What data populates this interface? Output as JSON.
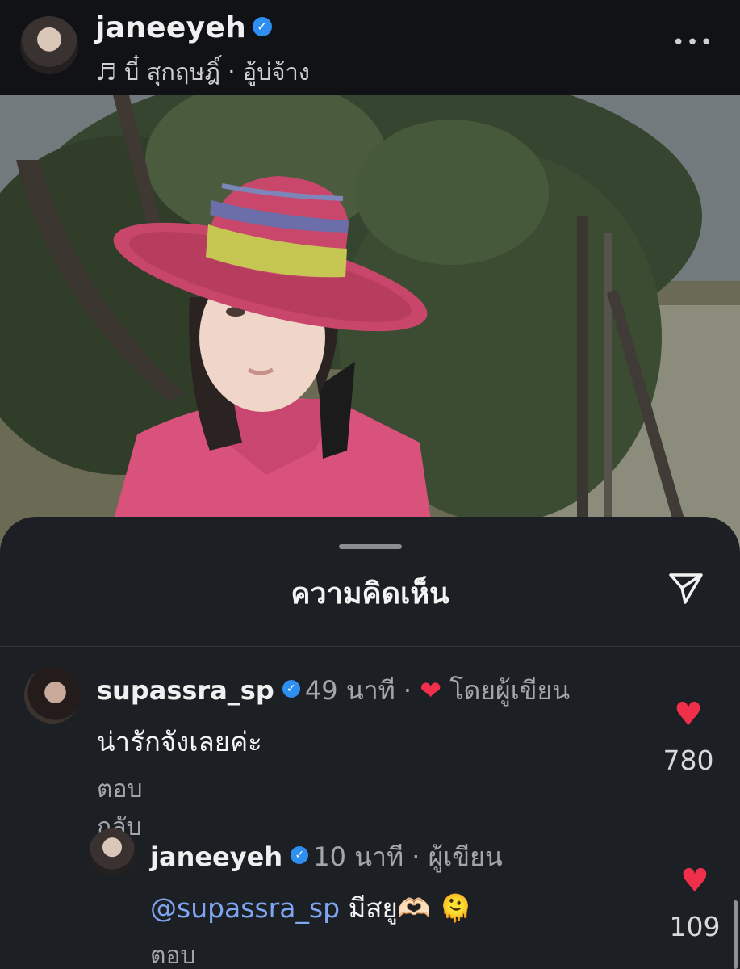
{
  "header": {
    "username": "janeeyeh",
    "music_icon": "♬",
    "music": "บี๋ สุกฤษฎิ์ · อู้บ่จ้าง",
    "more_icon": "•••"
  },
  "sheet": {
    "title": "ความคิดเห็น"
  },
  "comments": [
    {
      "user": "supassra_sp",
      "meta_time": "49 นาที · ",
      "heart": "❤",
      "meta_tag": " โดยผู้เขียน",
      "text": "น่ารักจังเลยค่ะ",
      "reply_label": "ตอบกลับ",
      "like_count": "780"
    },
    {
      "user": "janeeyeh",
      "meta_time": "10 นาที · ผู้เขียน",
      "mention": "@supassra_sp",
      "text": " มีสยู🫶🏻 🫠",
      "reply_label": "ตอบกลับ",
      "like_count": "109"
    }
  ],
  "colors": {
    "accent_heart": "#ef2f4c",
    "verified": "#2f8ff0",
    "mention": "#7fa6f0"
  }
}
